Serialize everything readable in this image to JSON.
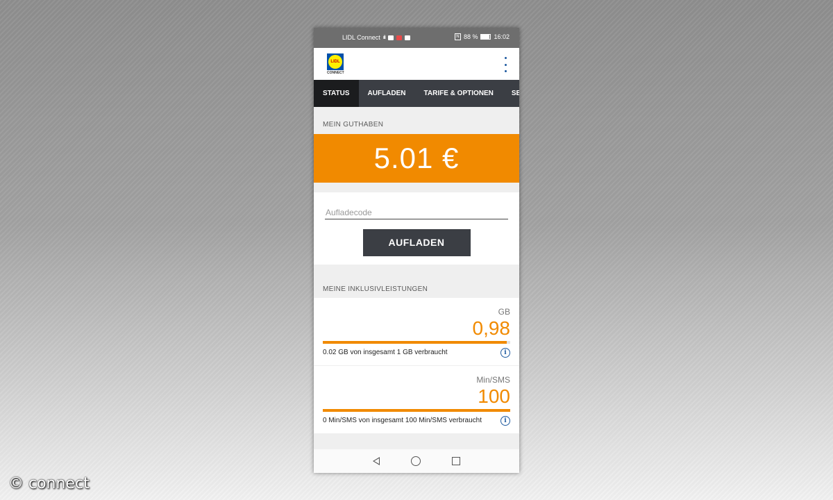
{
  "status_bar": {
    "carrier": "LIDL Connect",
    "network": "4G",
    "battery": "88 %",
    "time": "16:02"
  },
  "app": {
    "logo_text": "LIDL",
    "logo_subtext": "CONNECT"
  },
  "tabs": [
    {
      "label": "STATUS",
      "active": true
    },
    {
      "label": "AUFLADEN",
      "active": false
    },
    {
      "label": "TARIFE & OPTIONEN",
      "active": false
    },
    {
      "label": "SERVI",
      "active": false
    }
  ],
  "balance": {
    "label": "MEIN GUTHABEN",
    "value": "5.01 €"
  },
  "recharge": {
    "placeholder": "Aufladecode",
    "button_label": "AUFLADEN"
  },
  "inclusive": {
    "label": "MEINE INKLUSIVLEISTUNGEN",
    "items": [
      {
        "unit": "GB",
        "value": "0,98",
        "remaining_fraction": 0.98,
        "text": "0.02 GB von insgesamt 1 GB verbraucht",
        "info_icon": "info-icon"
      },
      {
        "unit": "Min/SMS",
        "value": "100",
        "remaining_fraction": 1.0,
        "text": "0 Min/SMS von insgesamt 100 Min/SMS verbraucht",
        "info_icon": "info-icon"
      }
    ]
  },
  "watermark": "© connect",
  "colors": {
    "accent": "#f18a00",
    "tabbar": "#3b3e44",
    "tab_active": "#1b1c1e",
    "info_blue": "#1e5aa0"
  }
}
